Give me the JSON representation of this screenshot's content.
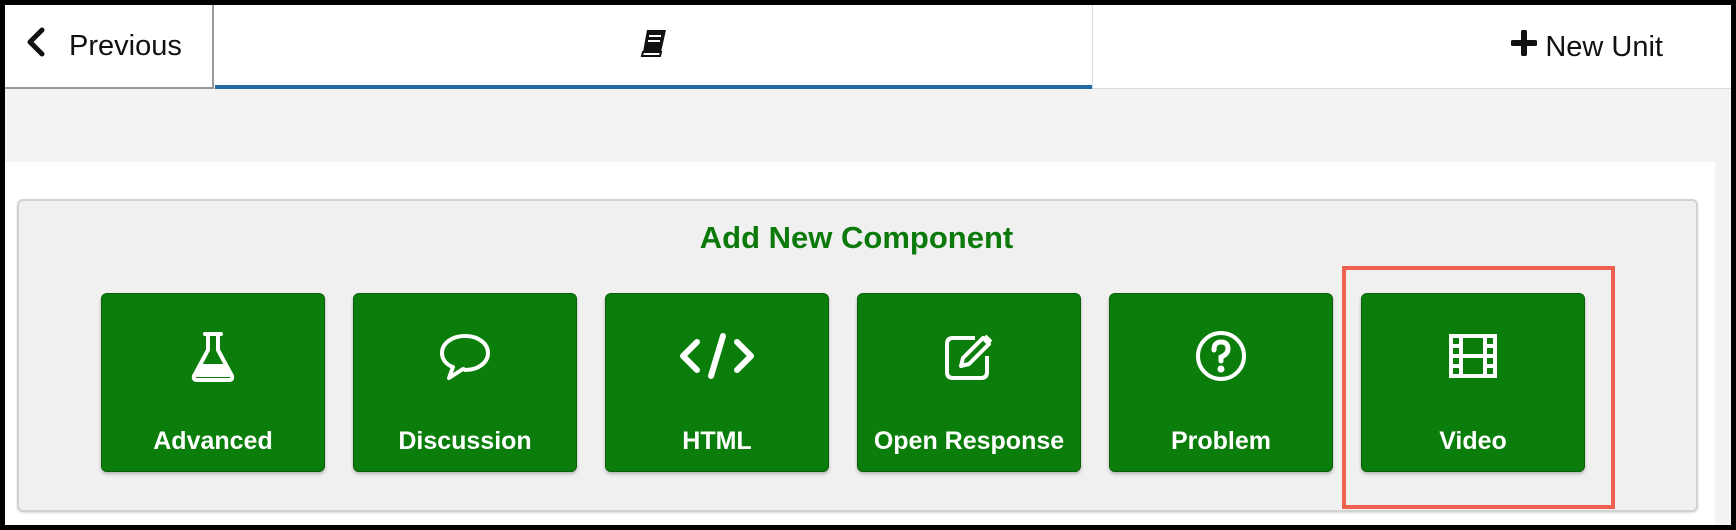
{
  "nav": {
    "previous_label": "Previous",
    "active_tab_icon": "book-icon",
    "new_unit_label": "New Unit"
  },
  "panel": {
    "title": "Add New Component"
  },
  "components": [
    {
      "label": "Advanced",
      "icon": "flask-icon"
    },
    {
      "label": "Discussion",
      "icon": "speech-bubble-icon"
    },
    {
      "label": "HTML",
      "icon": "code-icon"
    },
    {
      "label": "Open Response",
      "icon": "edit-icon"
    },
    {
      "label": "Problem",
      "icon": "question-circle-icon"
    },
    {
      "label": "Video",
      "icon": "film-icon"
    }
  ],
  "colors": {
    "component_bg": "#0b7d0b",
    "title_green": "#0b7a0b",
    "tab_underline": "#1f6aa5",
    "highlight": "#f0604f"
  }
}
